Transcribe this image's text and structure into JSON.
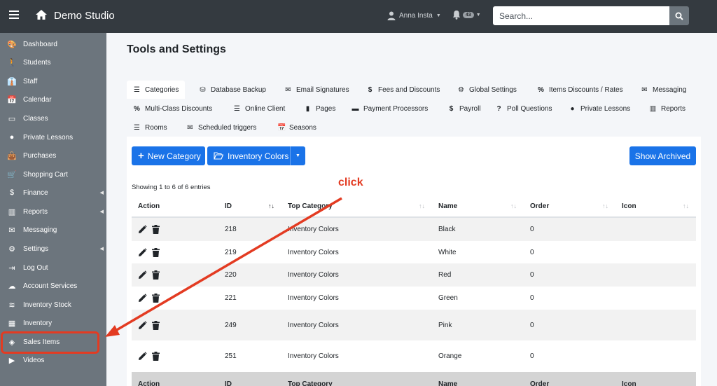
{
  "topbar": {
    "brand": "Demo Studio",
    "user_name": "Anna Insta",
    "notification_count": "43",
    "search_placeholder": "Search..."
  },
  "sidebar": {
    "items": [
      {
        "label": "Dashboard",
        "icon": "palette-icon"
      },
      {
        "label": "Students",
        "icon": "person-walking-icon"
      },
      {
        "label": "Staff",
        "icon": "user-tie-icon"
      },
      {
        "label": "Calendar",
        "icon": "calendar-icon"
      },
      {
        "label": "Classes",
        "icon": "chalkboard-icon"
      },
      {
        "label": "Private Lessons",
        "icon": "user-circle-icon"
      },
      {
        "label": "Purchases",
        "icon": "shopping-bag-icon"
      },
      {
        "label": "Shopping Cart",
        "icon": "shopping-cart-icon"
      },
      {
        "label": "Finance",
        "icon": "dollar-icon",
        "expand": true
      },
      {
        "label": "Reports",
        "icon": "chart-bar-icon",
        "expand": true
      },
      {
        "label": "Messaging",
        "icon": "envelope-icon"
      },
      {
        "label": "Settings",
        "icon": "cog-icon",
        "expand": true
      },
      {
        "label": "Log Out",
        "icon": "sign-out-icon"
      },
      {
        "label": "Account Services",
        "icon": "cloud-icon"
      },
      {
        "label": "Inventory Stock",
        "icon": "layers-icon"
      },
      {
        "label": "Inventory",
        "icon": "boxes-icon"
      },
      {
        "label": "Sales Items",
        "icon": "cubes-icon"
      },
      {
        "label": "Videos",
        "icon": "video-icon"
      }
    ]
  },
  "page": {
    "title": "Tools and Settings"
  },
  "tabs": {
    "row1": [
      {
        "label": "Categories",
        "icon": "list-icon",
        "active": true
      },
      {
        "label": "Database Backup",
        "icon": "database-icon"
      },
      {
        "label": "Email Signatures",
        "icon": "envelope-icon"
      },
      {
        "label": "Fees and Discounts",
        "icon": "dollar-icon"
      },
      {
        "label": "Global Settings",
        "icon": "cogs-icon"
      },
      {
        "label": "Items Discounts / Rates",
        "icon": "percent-icon"
      },
      {
        "label": "Messaging",
        "icon": "envelope-icon"
      }
    ],
    "row2": [
      {
        "label": "Multi-Class Discounts",
        "icon": "percent-icon"
      },
      {
        "label": "Online Client",
        "icon": "list-icon"
      },
      {
        "label": "Pages",
        "icon": "file-icon"
      },
      {
        "label": "Payment Processors",
        "icon": "credit-card-icon"
      },
      {
        "label": "Payroll",
        "icon": "dollar-icon"
      },
      {
        "label": "Poll Questions",
        "icon": "question-icon"
      },
      {
        "label": "Private Lessons",
        "icon": "user-circle-icon"
      },
      {
        "label": "Reports",
        "icon": "chart-bar-icon"
      }
    ],
    "row3": [
      {
        "label": "Rooms",
        "icon": "list-icon"
      },
      {
        "label": "Scheduled triggers",
        "icon": "envelope-icon"
      },
      {
        "label": "Seasons",
        "icon": "calendar-icon"
      }
    ]
  },
  "toolbar": {
    "new_label": "New Category",
    "inventory_label": "Inventory Colors",
    "archived_label": "Show Archived"
  },
  "table": {
    "showing": "Showing 1 to 6 of 6 entries",
    "headers": [
      "Action",
      "ID",
      "Top Category",
      "Name",
      "Order",
      "Icon"
    ],
    "rows": [
      {
        "id": "218",
        "top_category": "Inventory Colors",
        "name": "Black",
        "order": "0",
        "icon": ""
      },
      {
        "id": "219",
        "top_category": "Inventory Colors",
        "name": "White",
        "order": "0",
        "icon": ""
      },
      {
        "id": "220",
        "top_category": "Inventory Colors",
        "name": "Red",
        "order": "0",
        "icon": ""
      },
      {
        "id": "221",
        "top_category": "Inventory Colors",
        "name": "Green",
        "order": "0",
        "icon": ""
      },
      {
        "id": "249",
        "top_category": "Inventory Colors",
        "name": "Pink",
        "order": "0",
        "icon": ""
      },
      {
        "id": "251",
        "top_category": "Inventory Colors",
        "name": "Orange",
        "order": "0",
        "icon": ""
      }
    ]
  },
  "annotation": {
    "text": "click",
    "color": "#e33b22"
  },
  "colors": {
    "topbar": "#343a40",
    "sidebar": "#6c757d",
    "primary": "#1a73e8",
    "background": "#f4f6f9"
  }
}
